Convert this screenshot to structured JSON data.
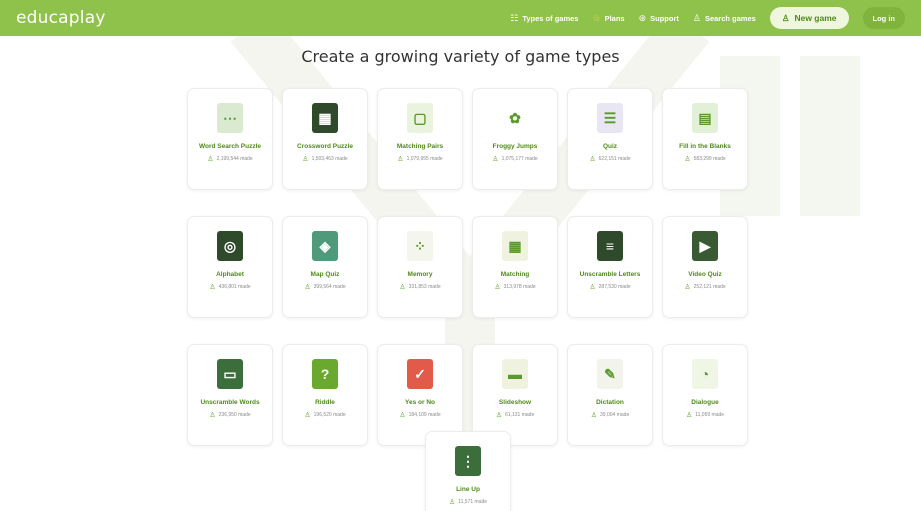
{
  "header": {
    "logo": "educaplay",
    "nav": [
      {
        "icon": "☷",
        "label": "Types of games",
        "icon_name": "types-icon"
      },
      {
        "icon": "☆",
        "label": "Plans",
        "icon_name": "star-icon"
      },
      {
        "icon": "⊛",
        "label": "Support",
        "icon_name": "support-icon"
      },
      {
        "icon": "♙",
        "label": "Search games",
        "icon_name": "search-games-icon"
      }
    ],
    "new_game": "New game",
    "login": "Log in"
  },
  "title": "Create a growing variety of game types",
  "games": [
    {
      "name": "Word Search Puzzle",
      "count": "2,199,544 made",
      "icon": "⋯",
      "color": "#d9ead0"
    },
    {
      "name": "Crossword Puzzle",
      "count": "1,503,463 made",
      "icon": "▦",
      "color": "#2f4a2a"
    },
    {
      "name": "Matching Pairs",
      "count": "1,079,955 made",
      "icon": "▢",
      "color": "#eaf3de"
    },
    {
      "name": "Froggy Jumps",
      "count": "1,075,177 made",
      "icon": "✿",
      "color": "#ffffff"
    },
    {
      "name": "Quiz",
      "count": "622,151 made",
      "icon": "☰",
      "color": "#e7e6f2"
    },
    {
      "name": "Fill in the Blanks",
      "count": "583,299 made",
      "icon": "▤",
      "color": "#e3f0d8"
    },
    {
      "name": "Alphabet",
      "count": "436,801 made",
      "icon": "◎",
      "color": "#2f4a2a"
    },
    {
      "name": "Map Quiz",
      "count": "399,564 made",
      "icon": "◈",
      "color": "#4f9a7a"
    },
    {
      "name": "Memory",
      "count": "331,853 made",
      "icon": "⁘",
      "color": "#f4f6ee"
    },
    {
      "name": "Matching",
      "count": "313,978 made",
      "icon": "▦",
      "color": "#eef2de"
    },
    {
      "name": "Unscramble Letters",
      "count": "287,530 made",
      "icon": "≡",
      "color": "#2f4a2a"
    },
    {
      "name": "Video Quiz",
      "count": "252,121 made",
      "icon": "▶",
      "color": "#3a5a34"
    },
    {
      "name": "Unscramble Words",
      "count": "236,950 made",
      "icon": "▭",
      "color": "#3b6e3a"
    },
    {
      "name": "Riddle",
      "count": "196,520 made",
      "icon": "?",
      "color": "#6aa82e"
    },
    {
      "name": "Yes or No",
      "count": "184,109 made",
      "icon": "✓",
      "color": "#e25a4a"
    },
    {
      "name": "Slideshow",
      "count": "61,131 made",
      "icon": "▬",
      "color": "#eef2de"
    },
    {
      "name": "Dictation",
      "count": "39,004 made",
      "icon": "✎",
      "color": "#f2f4ec"
    },
    {
      "name": "Dialogue",
      "count": "11,059 made",
      "icon": "◔",
      "color": "#f0f6e6"
    }
  ],
  "last_game": {
    "name": "Line Up",
    "count": "11,571 made",
    "icon": "⋮",
    "color": "#3b6e3a"
  }
}
